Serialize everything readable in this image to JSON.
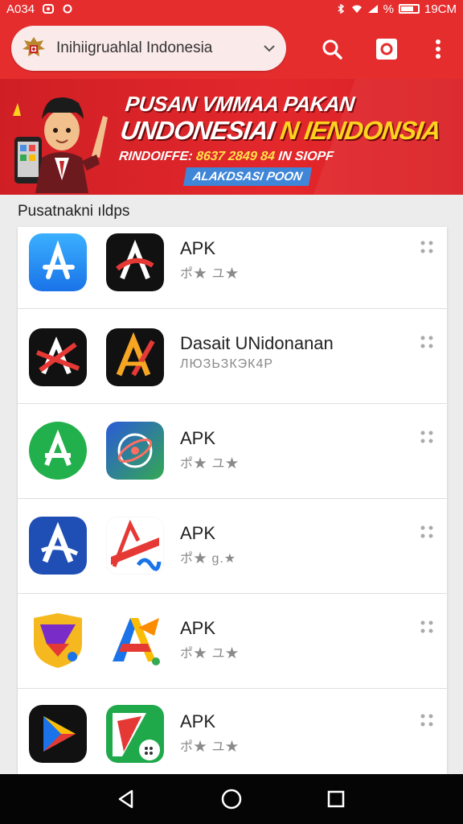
{
  "status_bar": {
    "left_text": "A034",
    "right_text": "% ",
    "time": "19CM",
    "icons": [
      "mail-icon",
      "sync-icon",
      "bluetooth-icon",
      "wifi-icon",
      "signal-icon",
      "battery-icon"
    ]
  },
  "app_bar": {
    "search_text": "Inihiigruahlal Indonesia",
    "icons": [
      "garuda-emblem-icon",
      "chevron-down-icon",
      "search-icon",
      "camera-icon",
      "more-vert-icon"
    ],
    "accent_color": "#e52d2e"
  },
  "banner": {
    "line1": "PUSAN VMMAA PAKAN",
    "line2_a": "UNDONESIAI ",
    "line2_b": "N IENDONSIA",
    "line3_a": "RINDOIFFE: ",
    "line3_b": "8637 2849 84",
    "line3_c": " IN SIOPF",
    "tag": "ALAKDSASI POON",
    "colors": {
      "background": "#d9242a",
      "highlight": "#ffd21f",
      "tag": "#3f86d8"
    }
  },
  "section": {
    "title": "Pusatnakni ıldps"
  },
  "apps": [
    {
      "title": "APK",
      "subtitle": "ポ★ ユ★",
      "icon_a": "app-store-icon",
      "icon_b": "red-a-icon"
    },
    {
      "title": "Dasait UNidonanan",
      "subtitle": "ЛЮЗЬЗКЭК4Р",
      "icon_a": "red-black-a-icon",
      "icon_b": "gold-a-icon"
    },
    {
      "title": "APK",
      "subtitle": "ポ★ ユ★",
      "icon_a": "green-a-icon",
      "icon_b": "globe-icon"
    },
    {
      "title": "APK",
      "subtitle": "ポ★ g.★",
      "icon_a": "blue-a-icon",
      "icon_b": "red-ribbon-icon"
    },
    {
      "title": "APK",
      "subtitle": "ポ★ ユ★",
      "icon_a": "shield-icon",
      "icon_b": "colorful-a-icon"
    },
    {
      "title": "APK",
      "subtitle": "ポ★ ユ★",
      "icon_a": "play-triangle-icon",
      "icon_b": "green-red-icon"
    }
  ],
  "nav_bar": {
    "icons": [
      "back-icon",
      "home-icon",
      "recents-icon"
    ]
  }
}
